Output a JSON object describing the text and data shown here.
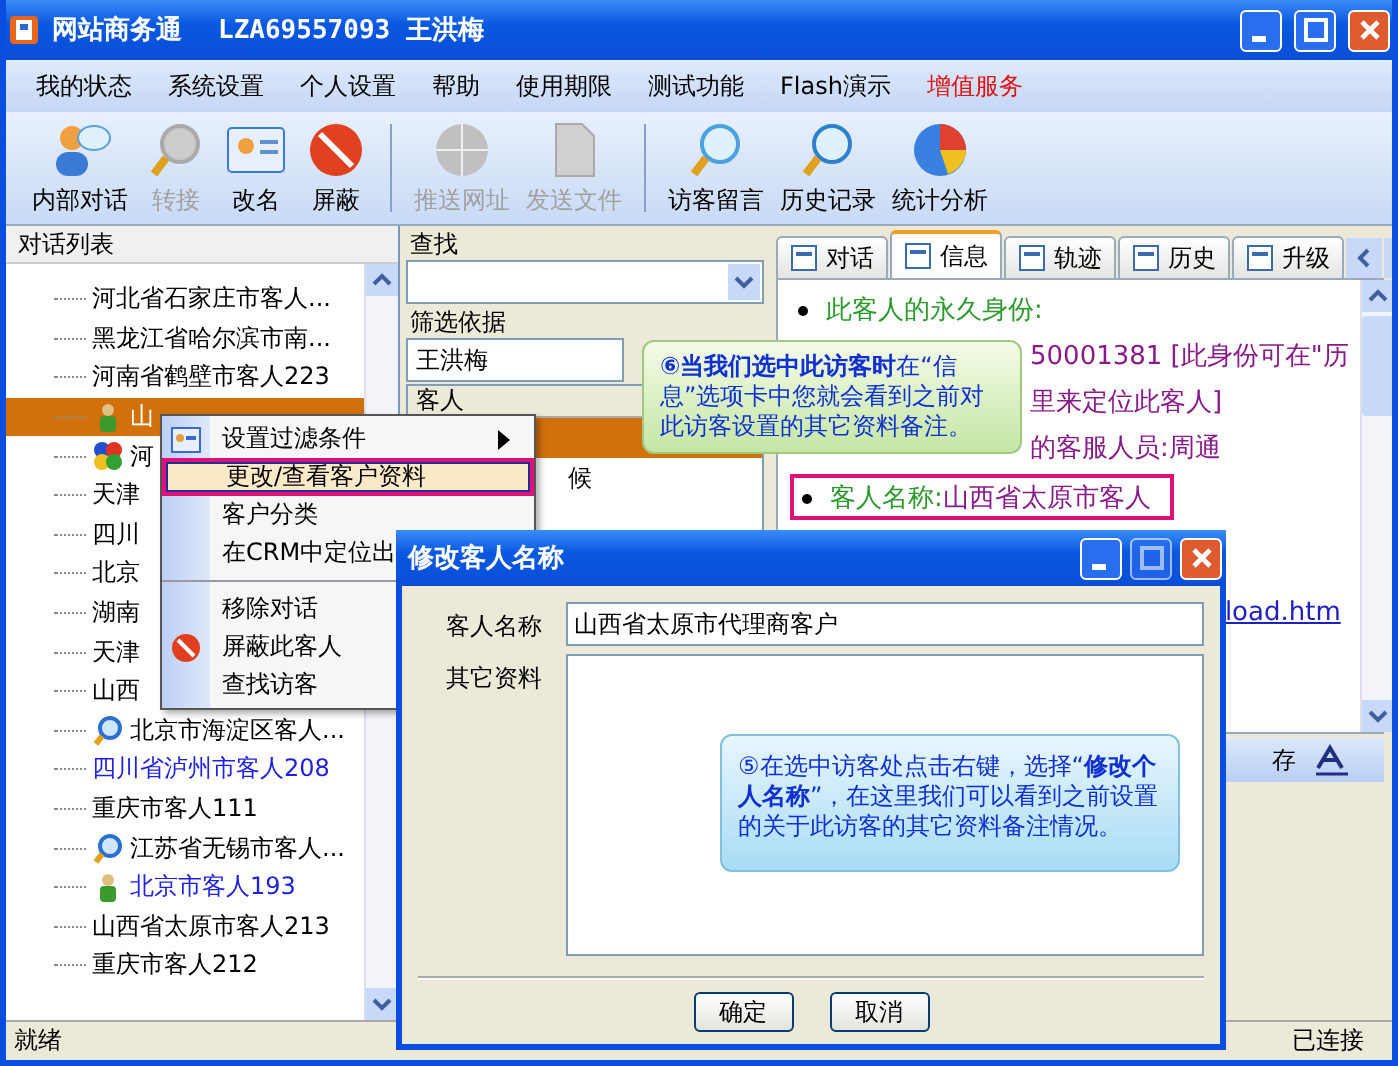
{
  "window": {
    "title": "网站商务通",
    "account": "LZA69557093 王洪梅"
  },
  "menu": [
    {
      "label": "我的状态",
      "kind": "normal"
    },
    {
      "label": "系统设置",
      "kind": "normal"
    },
    {
      "label": "个人设置",
      "kind": "normal"
    },
    {
      "label": "帮助",
      "kind": "normal"
    },
    {
      "label": "使用期限",
      "kind": "normal"
    },
    {
      "label": "测试功能",
      "kind": "normal"
    },
    {
      "label": "Flash演示",
      "kind": "normal"
    },
    {
      "label": "增值服务",
      "kind": "promo"
    }
  ],
  "toolbar": [
    [
      {
        "label": "内部对话",
        "kind": "chat",
        "disabled": false
      },
      {
        "label": "转接",
        "kind": "transfer",
        "disabled": true
      },
      {
        "label": "改名",
        "kind": "card",
        "disabled": false
      },
      {
        "label": "屏蔽",
        "kind": "block",
        "disabled": false
      }
    ],
    [
      {
        "label": "推送网址",
        "kind": "globe",
        "disabled": true
      },
      {
        "label": "发送文件",
        "kind": "file",
        "disabled": true
      }
    ],
    [
      {
        "label": "访客留言",
        "kind": "message",
        "disabled": false
      },
      {
        "label": "历史记录",
        "kind": "history",
        "disabled": false
      },
      {
        "label": "统计分析",
        "kind": "chart",
        "disabled": false
      }
    ]
  ],
  "conversation_list": {
    "title": "对话列表",
    "items": [
      {
        "label": "河北省石家庄市客人...",
        "kind": "plain",
        "color": "#000000",
        "selected": false
      },
      {
        "label": "黑龙江省哈尔滨市南...",
        "kind": "plain",
        "color": "#000000",
        "selected": false
      },
      {
        "label": "河南省鹤壁市客人223",
        "kind": "plain",
        "color": "#000000",
        "selected": false
      },
      {
        "label": "山",
        "kind": "person",
        "color": "#ffffff",
        "selected": true
      },
      {
        "label": "河",
        "kind": "balls",
        "color": "#000000",
        "selected": false
      },
      {
        "label": "天津",
        "kind": "plain",
        "color": "#000000",
        "selected": false
      },
      {
        "label": "四川",
        "kind": "plain",
        "color": "#000000",
        "selected": false
      },
      {
        "label": "北京",
        "kind": "plain",
        "color": "#000000",
        "selected": false
      },
      {
        "label": "湖南",
        "kind": "plain",
        "color": "#000000",
        "selected": false
      },
      {
        "label": "天津",
        "kind": "plain",
        "color": "#000000",
        "selected": false
      },
      {
        "label": "山西",
        "kind": "plain",
        "color": "#000000",
        "selected": false
      },
      {
        "label": "北京市海淀区客人...",
        "kind": "search",
        "color": "#000000",
        "selected": false
      },
      {
        "label": "四川省泸州市客人208",
        "kind": "plain",
        "color": "#2020e0",
        "selected": false
      },
      {
        "label": "重庆市客人111",
        "kind": "plain",
        "color": "#000000",
        "selected": false
      },
      {
        "label": "江苏省无锡市客人...",
        "kind": "search",
        "color": "#000000",
        "selected": false
      },
      {
        "label": "北京市客人193",
        "kind": "person",
        "color": "#2020e0",
        "selected": false
      },
      {
        "label": "山西省太原市客人213",
        "kind": "plain",
        "color": "#000000",
        "selected": false
      },
      {
        "label": "重庆市客人212",
        "kind": "plain",
        "color": "#000000",
        "selected": false
      }
    ]
  },
  "filter_panel": {
    "search_label": "查找",
    "filter_label": "筛选依据",
    "filter_value": "王洪梅",
    "column_header": "客人",
    "rows": [
      {
        "text": "",
        "selected": true
      },
      {
        "text": "候",
        "selected": false
      }
    ]
  },
  "info_panel": {
    "tabs": [
      {
        "label": "对话",
        "selected": false
      },
      {
        "label": "信息",
        "selected": true
      },
      {
        "label": "轨迹",
        "selected": false
      },
      {
        "label": "历史",
        "selected": false
      },
      {
        "label": "升级",
        "selected": false
      }
    ],
    "lines": [
      {
        "kind": "bullet",
        "text": "此客人的永久身份:"
      },
      {
        "kind": "fragment",
        "text": "50001381 [此身份可在\"历"
      },
      {
        "kind": "fragment",
        "text": "里来定位此客人]"
      },
      {
        "kind": "fragment",
        "text": "的客服人员:周通"
      },
      {
        "kind": "field",
        "label": "客人名称:",
        "value": "山西省太原市客人"
      },
      {
        "kind": "link",
        "text": "load.htm"
      }
    ],
    "bottom_text": "存"
  },
  "context_menu": [
    {
      "label": "设置过滤条件",
      "kind": "filter",
      "selected": false,
      "separator_before": false
    },
    {
      "label": "更改/查看客户资料",
      "kind": "plain",
      "selected": true,
      "separator_before": false
    },
    {
      "label": "客户分类",
      "kind": "plain",
      "selected": false,
      "separator_before": false
    },
    {
      "label": "在CRM中定位出",
      "kind": "plain",
      "selected": false,
      "separator_before": false
    },
    {
      "label": "移除对话",
      "kind": "plain",
      "selected": false,
      "separator_before": true
    },
    {
      "label": "屏蔽此客人",
      "kind": "block",
      "selected": false,
      "separator_before": false
    },
    {
      "label": "查找访客",
      "kind": "plain",
      "selected": false,
      "separator_before": false
    }
  ],
  "dialog": {
    "title": "修改客人名称",
    "name_label": "客人名称",
    "name_value": "山西省太原市代理商客户",
    "notes_label": "其它资料",
    "buttons": [
      "确定",
      "取消"
    ]
  },
  "callouts": [
    {
      "kind": "green",
      "text": "**⑥当我们选中此访客时**在“信息”选项卡中您就会看到之前对此访客设置的其它资料备注。"
    },
    {
      "kind": "blue",
      "text": "⑤在选中访客处点击右键，选择“**修改个人名称**”，在这里我们可以看到之前设置的关于此访客的其它资料备注情况。"
    }
  ],
  "status_bar": {
    "left": "就绪",
    "right": "已连接"
  }
}
